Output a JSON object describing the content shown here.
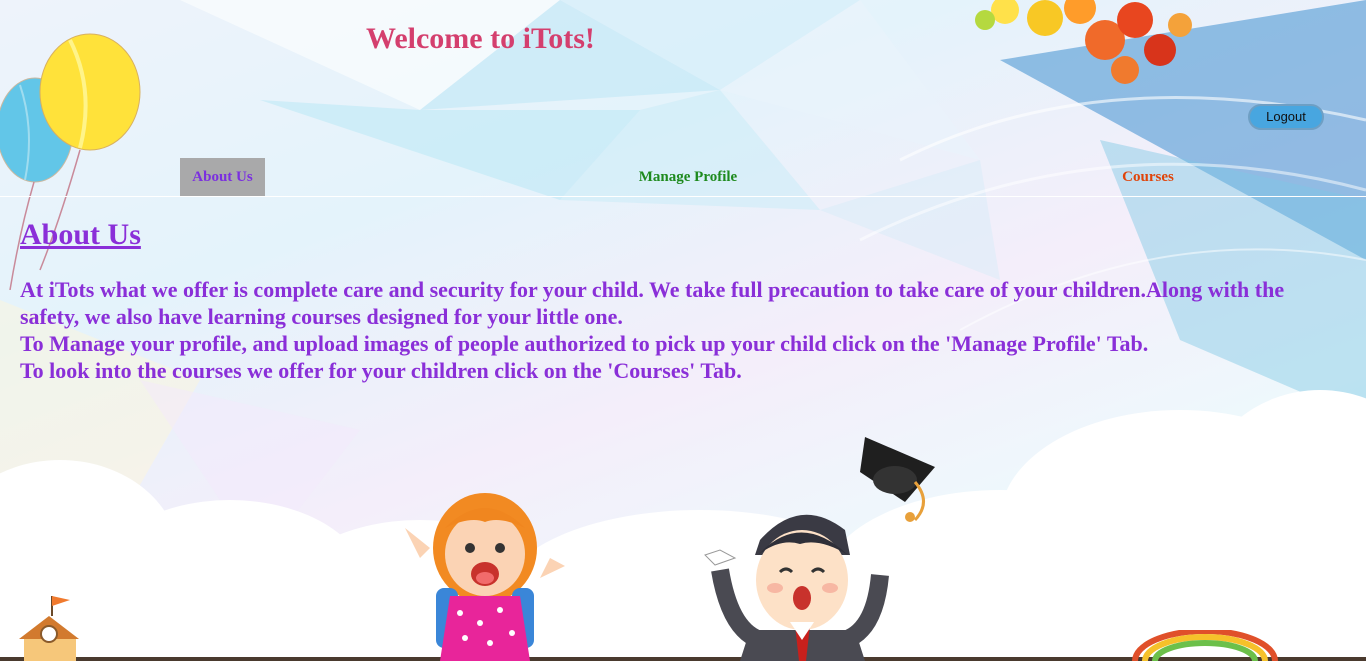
{
  "header": {
    "title": "Welcome to iTots!"
  },
  "logout": {
    "label": "Logout"
  },
  "nav": {
    "about": "About Us",
    "profile": "Manage Profile",
    "courses": "Courses"
  },
  "about": {
    "heading": "About Us",
    "paragraph1": "At iTots what we offer is complete care and security for your child. We take full precaution to take care of your children.Along with the safety, we also have learning courses designed for your little one.",
    "paragraph2": "To Manage your profile, and upload images of people authorized to pick up your child click on the 'Manage Profile' Tab.",
    "paragraph3": "To look into the courses we offer for your children click on the 'Courses' Tab."
  },
  "colors": {
    "title": "#d43f6e",
    "nav_active_bg": "#a9a9aa",
    "nav_about": "#7b2fe0",
    "nav_profile": "#1e8a1e",
    "nav_courses": "#e0440a",
    "content_text": "#8a2fd8",
    "logout_bg": "#48a6e0"
  },
  "icons": [
    "balloons-icon",
    "autumn-leaves-icon",
    "girl-illustration-icon",
    "graduate-boy-illustration-icon",
    "graduation-cap-icon",
    "clouds-icon",
    "school-house-icon",
    "rainbow-icon"
  ]
}
